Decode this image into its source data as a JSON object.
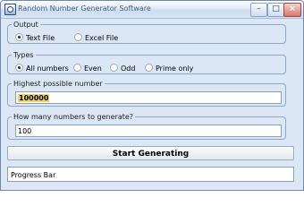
{
  "window": {
    "title": "Random Number Generator Software"
  },
  "output": {
    "legend": "Output",
    "options": [
      {
        "label": "Text File",
        "selected": true
      },
      {
        "label": "Excel File",
        "selected": false
      }
    ]
  },
  "types": {
    "legend": "Types",
    "options": [
      {
        "label": "All numbers",
        "selected": true
      },
      {
        "label": "Even",
        "selected": false
      },
      {
        "label": "Odd",
        "selected": false
      },
      {
        "label": "Prime only",
        "selected": false
      }
    ]
  },
  "highest": {
    "legend": "Highest possible number",
    "value": "100000"
  },
  "count": {
    "legend": "How many numbers to generate?",
    "value": "100"
  },
  "start_button": {
    "label": "Start Generating"
  },
  "progress": {
    "label": "Progress Bar"
  }
}
